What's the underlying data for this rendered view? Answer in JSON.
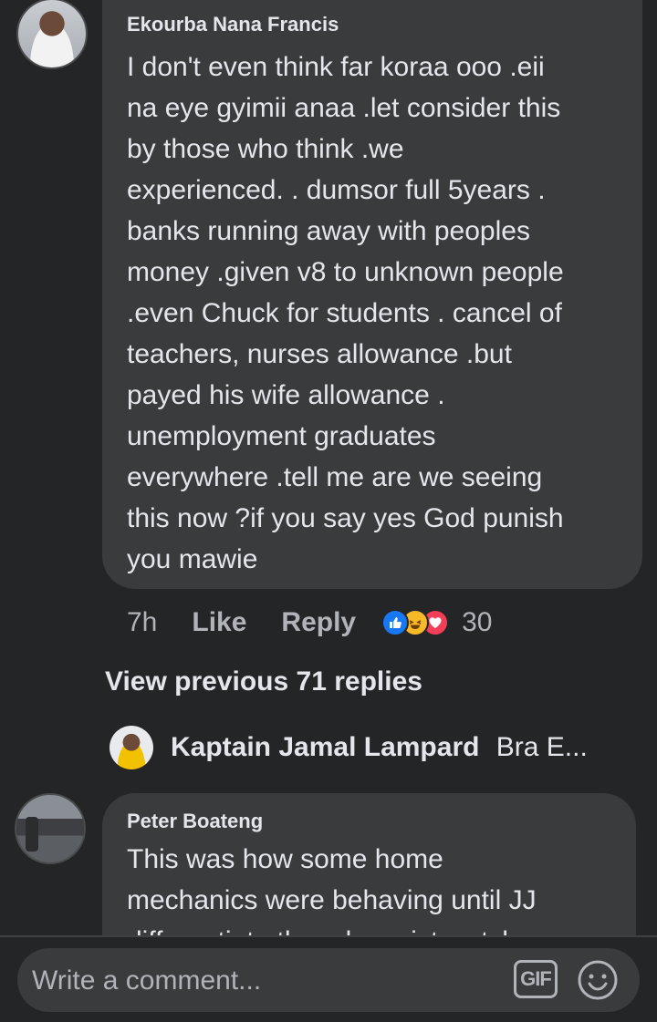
{
  "comment_1": {
    "author": "Ekourba Nana Francis",
    "text": "I don't even think far koraa ooo .eii\nna eye gyimii anaa .let consider this\nby those who think .we\nexperienced. . dumsor full 5years .\nbanks running away with peoples\nmoney .given v8 to unknown people\n.even Chuck for students . cancel of\nteachers, nurses allowance .but\npayed his wife allowance .\nunemployment graduates\neverywhere .tell me are we seeing\nthis now ?if you say yes God punish\nyou mawie",
    "time": "7h",
    "like_label": "Like",
    "reply_label": "Reply",
    "reaction_icons": [
      "like-icon",
      "haha-icon",
      "love-icon"
    ],
    "reaction_count": "30"
  },
  "view_previous": "View previous 71 replies",
  "reply_preview": {
    "author": "Kaptain Jamal Lampard",
    "snippet": "Bra E..."
  },
  "comment_2": {
    "author": "Peter Boateng",
    "text": "This was how some home\nmechanics were behaving until JJ\ndifferentiate them by wrist watch"
  },
  "composer": {
    "placeholder": "Write a comment...",
    "gif_label": "GIF"
  },
  "colors": {
    "background": "#242526",
    "bubble": "#3a3b3c",
    "text_primary": "#e4e6eb",
    "text_secondary": "#b0b3b8",
    "like_blue": "#1877f2",
    "haha_yellow": "#f7b928",
    "love_red": "#f33e58"
  }
}
